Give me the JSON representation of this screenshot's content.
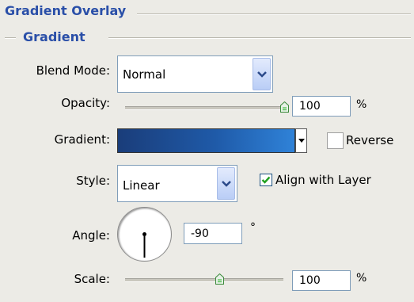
{
  "panel": {
    "title": "Gradient Overlay",
    "subtitle": "Gradient"
  },
  "fields": {
    "blend_mode_label": "Blend Mode:",
    "blend_mode_value": "Normal",
    "opacity_label": "Opacity:",
    "opacity_value": "100",
    "opacity_unit": "%",
    "opacity_slider_fraction": 1.0,
    "gradient_label": "Gradient:",
    "gradient_colors": [
      "#1a3d7a",
      "#2f82d8"
    ],
    "reverse_label": "Reverse",
    "reverse_checked": false,
    "style_label": "Style:",
    "style_value": "Linear",
    "align_label": "Align with Layer",
    "align_checked": true,
    "angle_label": "Angle:",
    "angle_value": "-90",
    "angle_unit": "°",
    "scale_label": "Scale:",
    "scale_value": "100",
    "scale_unit": "%",
    "scale_slider_fraction": 0.5
  },
  "colors": {
    "title": "#2a4fa8",
    "background": "#ecebe6",
    "checkmark": "#21a121"
  },
  "icons": {
    "dropdown": "chevron-down-icon",
    "checkmark": "check-icon",
    "slider": "slider-thumb-icon"
  }
}
